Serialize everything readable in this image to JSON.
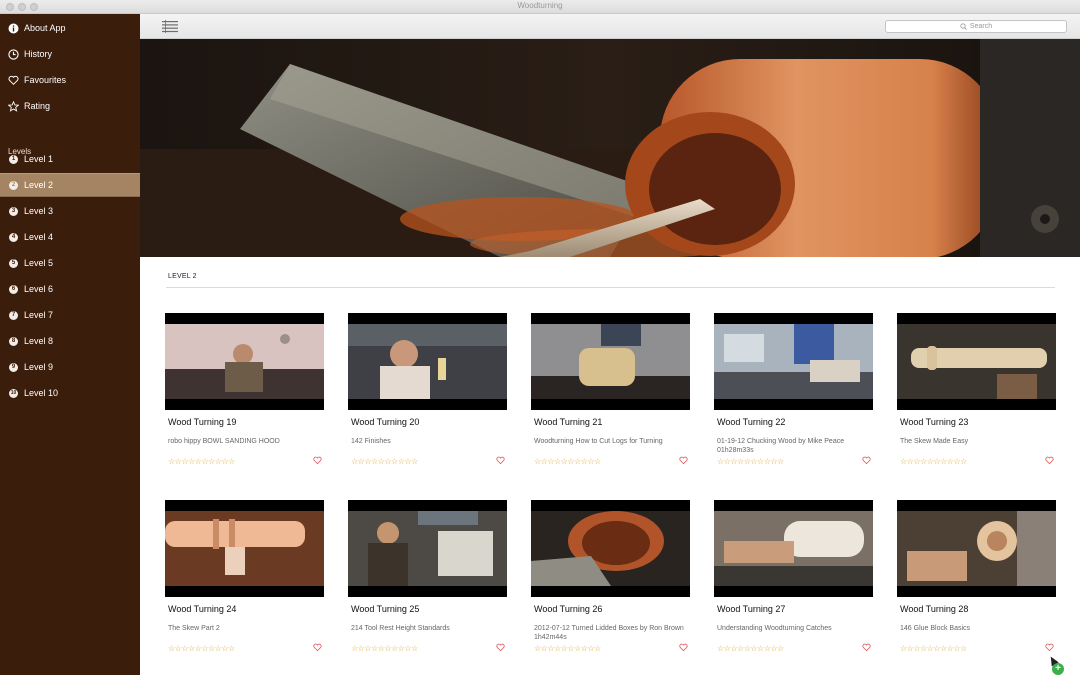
{
  "window": {
    "title": "Woodturning"
  },
  "sidebar": {
    "top_items": [
      {
        "label": "About App",
        "icon": "info-icon"
      },
      {
        "label": "History",
        "icon": "clock-icon"
      },
      {
        "label": "Favourites",
        "icon": "heart-icon"
      },
      {
        "label": "Rating",
        "icon": "star-icon"
      }
    ],
    "levels_heading": "Levels",
    "levels": [
      {
        "label": "Level 1",
        "num": "1"
      },
      {
        "label": "Level 2",
        "num": "2",
        "active": true
      },
      {
        "label": "Level 3",
        "num": "3"
      },
      {
        "label": "Level 4",
        "num": "4"
      },
      {
        "label": "Level 5",
        "num": "5"
      },
      {
        "label": "Level 6",
        "num": "6"
      },
      {
        "label": "Level 7",
        "num": "7"
      },
      {
        "label": "Level 8",
        "num": "8"
      },
      {
        "label": "Level 9",
        "num": "9"
      },
      {
        "label": "Level 10",
        "num": "10"
      }
    ]
  },
  "toolbar": {
    "search_placeholder": "Search"
  },
  "main": {
    "level_title": "LEVEL 2",
    "videos": [
      {
        "title": "Wood Turning 19",
        "subtitle": "robo hippy BOWL SANDING HOOD",
        "rating": 0
      },
      {
        "title": "Wood Turning 20",
        "subtitle": "142  Finishes",
        "rating": 0
      },
      {
        "title": "Wood Turning 21",
        "subtitle": "Woodturning How to Cut Logs for Turning",
        "rating": 0
      },
      {
        "title": "Wood Turning 22",
        "subtitle": "01-19-12 Chucking Wood by Mike Peace 01h28m33s",
        "rating": 0
      },
      {
        "title": "Wood Turning 23",
        "subtitle": "The Skew Made Easy",
        "rating": 0
      },
      {
        "title": "Wood Turning 24",
        "subtitle": "The Skew Part 2",
        "rating": 0
      },
      {
        "title": "Wood Turning 25",
        "subtitle": "214 Tool Rest Height Standards",
        "rating": 0
      },
      {
        "title": "Wood Turning 26",
        "subtitle": "2012-07-12 Turned Lidded Boxes by Ron Brown 1h42m44s",
        "rating": 0
      },
      {
        "title": "Wood Turning 27",
        "subtitle": "Understanding Woodturning Catches",
        "rating": 0
      },
      {
        "title": "Wood Turning 28",
        "subtitle": "146  Glue Block Basics",
        "rating": 0
      }
    ],
    "star_count": 10
  },
  "colors": {
    "sidebar_bg": "#3b1d0c",
    "active_item": "#a58463",
    "star": "#d9a431",
    "heart": "#e0565b"
  }
}
